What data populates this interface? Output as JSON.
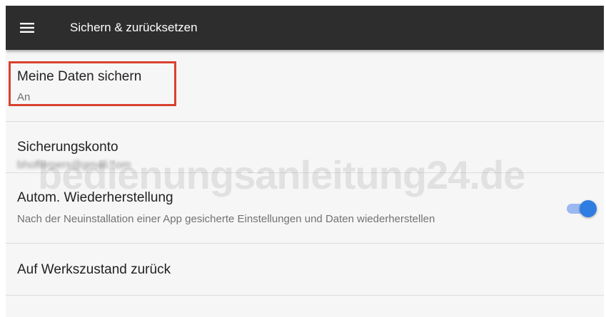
{
  "toolbar": {
    "menu_icon": "hamburger-menu-icon",
    "title": "Sichern & zurücksetzen",
    "background": "#2d2d2d"
  },
  "settings": {
    "items": [
      {
        "title": "Meine Daten sichern",
        "subtitle": "An",
        "highlighted": true,
        "highlight_color": "#d9412e"
      },
      {
        "title": "Sicherungskonto",
        "subtitle": "bhofferpers@gmail.com"
      },
      {
        "title": "Autom. Wiederherstellung",
        "subtitle": "Nach der Neuinstallation einer App gesicherte Einstellungen und Daten wiederherstellen",
        "toggle_on": true,
        "toggle_color": "#2f7de1"
      },
      {
        "title": "Auf Werkszustand zurück"
      }
    ]
  },
  "watermark": {
    "text": "bedienungsanleitung24.de"
  }
}
